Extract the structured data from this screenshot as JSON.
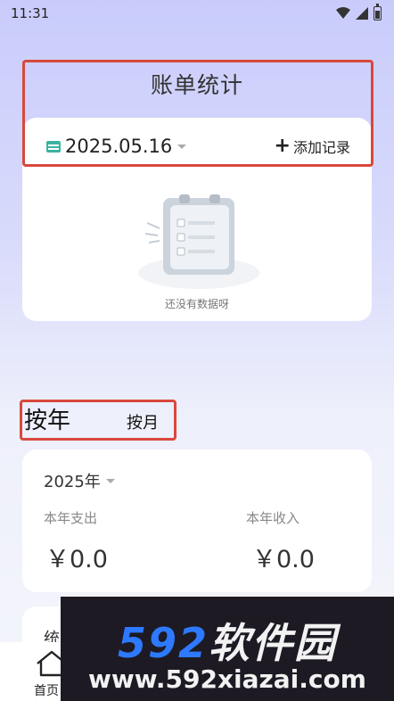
{
  "status_bar": {
    "time": "11:31",
    "icons": [
      "wifi-icon",
      "signal-icon",
      "battery-icon"
    ]
  },
  "header": {
    "title": "账单统计"
  },
  "record_card": {
    "date": "2025.05.16",
    "add_label": "添加记录",
    "empty_text": "还没有数据呀",
    "icons": [
      "calendar-icon",
      "plus-icon",
      "empty-clipboard-illustration"
    ]
  },
  "segment": {
    "year_label": "按年",
    "month_label": "按月",
    "active": "按年"
  },
  "stats_card": {
    "year": "2025年",
    "expense_label": "本年支出",
    "income_label": "本年收入",
    "expense_value": "￥0.0",
    "income_value": "￥0.0"
  },
  "bottom_card": {
    "partial_label": "统"
  },
  "tabbar": {
    "home_label": "首页",
    "home_icon": "home-icon"
  },
  "watermark": {
    "brand_num": "592",
    "brand_text": "软件园",
    "url": "www.592xiazai.com"
  },
  "colors": {
    "highlight": "#d9483b",
    "accent_blue": "#2d79ff",
    "bg_top": "#c9ccfb"
  }
}
